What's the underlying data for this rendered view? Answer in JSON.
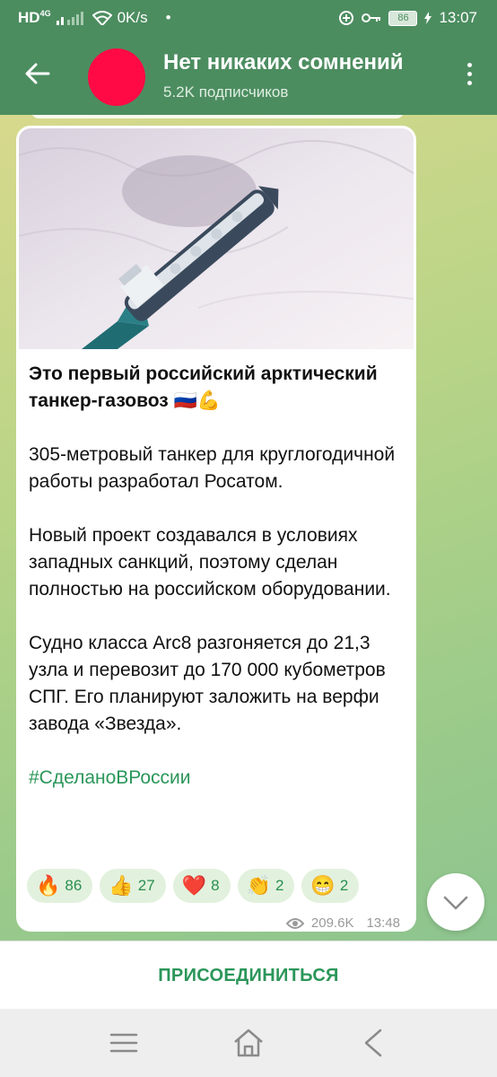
{
  "status": {
    "network": "HD",
    "network_gen": "4G",
    "speed": "0K/s",
    "dot": "•",
    "battery": "86",
    "time": "13:07"
  },
  "header": {
    "title": "Нет никаких сомнений",
    "subtitle": "5.2K подписчиков"
  },
  "post": {
    "headline": "Это первый российский арктический танкер-газовоз",
    "headline_emoji": "🇷🇺💪",
    "paragraphs": [
      "305-метровый танкер для круглогодичной работы разработал Росатом.",
      "Новый проект создавался в условиях западных санкций, поэтому сделан полностью на российском оборудовании.",
      "Судно класса Arc8 разгоняется до 21,3 узла и перевозит до 170 000 кубометров СПГ. Его планируют заложить на верфи завода «Звезда»."
    ],
    "hashtag": "#СделаноВРоссии",
    "reactions": [
      {
        "emoji": "🔥",
        "count": "86"
      },
      {
        "emoji": "👍",
        "count": "27"
      },
      {
        "emoji": "❤️",
        "count": "8"
      },
      {
        "emoji": "👏",
        "count": "2"
      },
      {
        "emoji": "😁",
        "count": "2"
      }
    ],
    "views": "209.6K",
    "time": "13:48"
  },
  "join_label": "ПРИСОЕДИНИТЬСЯ",
  "colors": {
    "header": "#4c8d60",
    "accent": "#2b9659",
    "avatar": "#ff0a45"
  }
}
